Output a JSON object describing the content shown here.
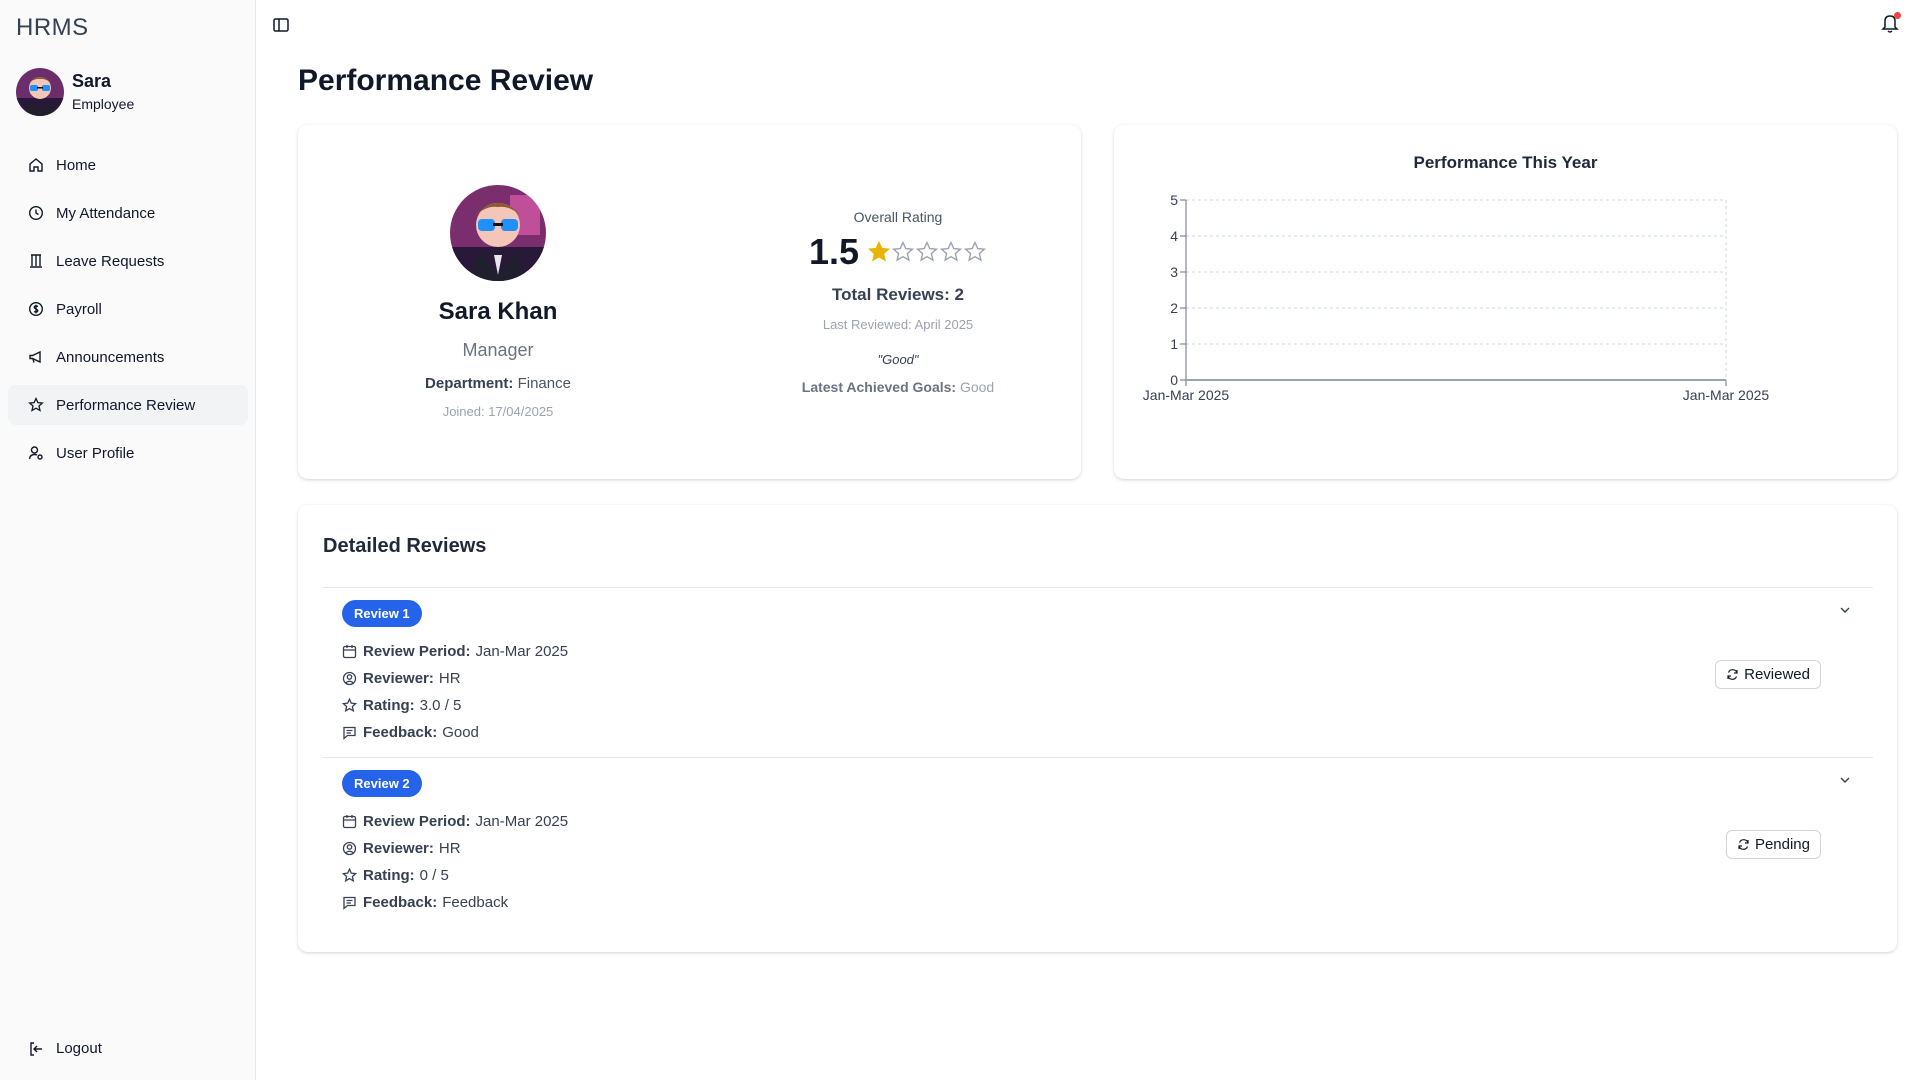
{
  "app": {
    "brand": "HRMS"
  },
  "user": {
    "name": "Sara",
    "role": "Employee"
  },
  "sidebar": {
    "items": [
      {
        "label": "Home",
        "icon": "home-icon"
      },
      {
        "label": "My Attendance",
        "icon": "clock-icon"
      },
      {
        "label": "Leave Requests",
        "icon": "bank-icon"
      },
      {
        "label": "Payroll",
        "icon": "dollar-icon"
      },
      {
        "label": "Announcements",
        "icon": "megaphone-icon"
      },
      {
        "label": "Performance Review",
        "icon": "star-icon",
        "active": true
      },
      {
        "label": "User Profile",
        "icon": "user-cog-icon"
      }
    ],
    "logout": "Logout"
  },
  "page": {
    "title": "Performance Review"
  },
  "profile": {
    "name": "Sara Khan",
    "title": "Manager",
    "department_label": "Department:",
    "department": "Finance",
    "joined": "Joined: 17/04/2025"
  },
  "rating": {
    "label": "Overall Rating",
    "value": "1.5",
    "stars_filled": 1,
    "stars_total": 5,
    "total_reviews": "Total Reviews: 2",
    "last_reviewed": "Last Reviewed: April 2025",
    "quote": "\"Good\"",
    "goals_label": "Latest Achieved Goals:",
    "goals_value": "Good"
  },
  "chart_data": {
    "type": "line",
    "title": "Performance This Year",
    "x": [
      "Jan-Mar 2025",
      "Jan-Mar 2025"
    ],
    "yticks": [
      "0",
      "1",
      "2",
      "3",
      "4",
      "5"
    ],
    "ylim": [
      0,
      5
    ],
    "grid": true,
    "series": [
      {
        "values": [
          0,
          0
        ]
      }
    ]
  },
  "details": {
    "title": "Detailed Reviews",
    "labels": {
      "period": "Review Period:",
      "reviewer": "Reviewer:",
      "rating": "Rating:",
      "feedback": "Feedback:"
    },
    "reviews": [
      {
        "badge": "Review 1",
        "period": "Jan-Mar 2025",
        "reviewer": "HR",
        "rating": "3.0 / 5",
        "feedback": "Good",
        "status": "Reviewed"
      },
      {
        "badge": "Review 2",
        "period": "Jan-Mar 2025",
        "reviewer": "HR",
        "rating": "0 / 5",
        "feedback": "Feedback",
        "status": "Pending"
      }
    ]
  },
  "colors": {
    "accent": "#2563eb",
    "star": "#eab308",
    "notification": "#ef4444"
  }
}
